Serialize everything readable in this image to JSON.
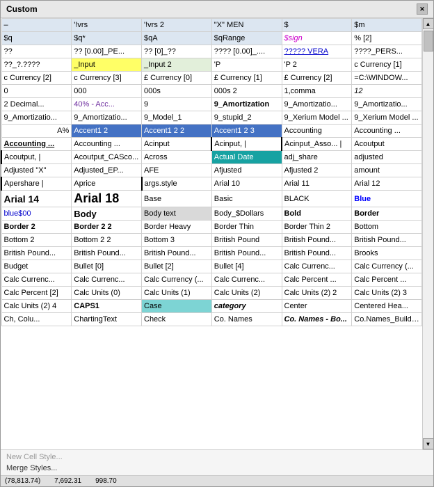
{
  "window": {
    "title": "Custom",
    "scrollbar": "▲"
  },
  "footer": {
    "new_style": "New Cell Style...",
    "merge_styles": "Merge Styles..."
  },
  "status": {
    "val1": "(78,813.74)",
    "val2": "7,692.31",
    "val3": "998.70"
  },
  "rows": [
    [
      "–",
      "'!vrs",
      "'!vrs 2",
      "\"X\" MEN",
      "$",
      "$m"
    ],
    [
      "$q",
      "$q*",
      "$qA",
      "$qRange",
      "$sign",
      "% [2]"
    ],
    [
      "??",
      "?? [0.00]_PE...",
      "?? [0]_??",
      "???? [0.00]_....",
      "?????  VERA",
      "????_PERS..."
    ],
    [
      "??_?.????",
      "_Input",
      "_Input 2",
      "'P",
      "'P 2",
      "c Currency [1]"
    ],
    [
      "c Currency [2]",
      "c Currency [3]",
      "£ Currency [0]",
      "£ Currency [1]",
      "£ Currency [2]",
      "=C:\\WINDOW..."
    ],
    [
      "0",
      "000",
      "000s",
      "000s 2",
      "1,comma",
      "12"
    ],
    [
      "2 Decimal...",
      "40% - Acc...",
      "9",
      "9_Amortization",
      "9_Amortizatio...",
      "9_Amortizatio..."
    ],
    [
      "9_Amortizatio...",
      "9_Amortizatio...",
      "9_Model_1",
      "9_stupid_2",
      "9_Xerium Model ...",
      "9_Xerium Model ..."
    ],
    [
      "A%",
      "Accent1 2",
      "Accent1 2 2",
      "Accent1 2 3",
      "Accounting",
      "Accounting ..."
    ],
    [
      "Accounting ...",
      "Accounting ...",
      "Acinput",
      "Acinput, |",
      "Acinput_Asso... |",
      "Acoutput"
    ],
    [
      "Acoutput, |",
      "Acoutput_CASco...",
      "Across",
      "Actual Date",
      "adj_share",
      "adjusted"
    ],
    [
      "Adjusted \"X\"",
      "Adjusted_EP...",
      "AFE",
      "Afjusted",
      "Afjusted 2",
      "amount"
    ],
    [
      "Apershare |",
      "Aprice",
      "args.style",
      "Arial 10",
      "Arial 11",
      "Arial 12"
    ],
    [
      "Arial 14",
      "Arial 18",
      "Base",
      "Basic",
      "BLACK",
      "Blue"
    ],
    [
      "blue$00",
      "Body",
      "Body text",
      "Body_$Dollars",
      "Bold",
      "Border"
    ],
    [
      "Border 2",
      "Border 2 2",
      "Border Heavy",
      "Border Thin",
      "Border Thin 2",
      "Bottom"
    ],
    [
      "Bottom 2",
      "Bottom 2 2",
      "Bottom 3",
      "British Pound",
      "British Pound...",
      "British Pound..."
    ],
    [
      "British Pound...",
      "British Pound...",
      "British Pound...",
      "British Pound...",
      "British Pound...",
      "Brooks"
    ],
    [
      "Budget",
      "Bullet [0]",
      "Bullet [2]",
      "Bullet [4]",
      "Calc Currenc...",
      "Calc Currency (..."
    ],
    [
      "Calc Currenc...",
      "Calc Currenc...",
      "Calc Currency (...",
      "Calc Currenc...",
      "Calc Percent ...",
      "Calc Percent ..."
    ],
    [
      "Calc Percent [2]",
      "Calc Units (0)",
      "Calc Units (1)",
      "Calc Units (2)",
      "Calc Units (2) 2",
      "Calc Units (2) 3"
    ],
    [
      "Calc Units (2) 4",
      "CAPS1",
      "Case",
      "category",
      "Center",
      "Centered Hea..."
    ],
    [
      "Ch, Colu...",
      "ChartingText",
      "Check",
      "Co. Names",
      "Co. Names - Bo...",
      "Co.Names_Buildup..."
    ]
  ],
  "cell_styles": {
    "row0": [
      "normal",
      "normal",
      "normal",
      "normal",
      "normal",
      "normal"
    ],
    "row1_col0_bg": "#dce6f1",
    "row1_col1_bg": "#dce6f1",
    "row1_col2_bg": "#dce6f1",
    "row1_col3_bg": "#dce6f1"
  }
}
